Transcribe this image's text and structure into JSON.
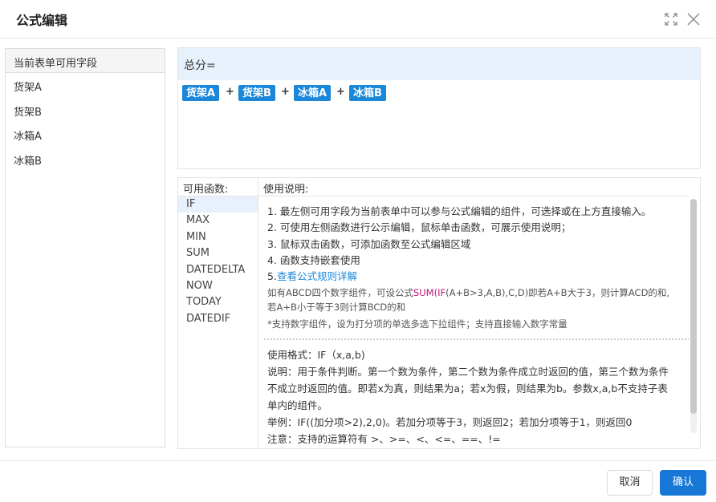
{
  "dialog": {
    "title": "公式编辑"
  },
  "icons": {
    "expand": "expand-icon",
    "close": "close-icon"
  },
  "fields_panel": {
    "header": "当前表单可用字段",
    "items": [
      "货架A",
      "货架B",
      "冰箱A",
      "冰箱B"
    ]
  },
  "editor": {
    "label": "总分=",
    "tokens": [
      {
        "type": "field",
        "text": "货架A"
      },
      {
        "type": "op",
        "text": "+"
      },
      {
        "type": "field",
        "text": "货架B"
      },
      {
        "type": "op",
        "text": "+"
      },
      {
        "type": "field",
        "text": "冰箱A"
      },
      {
        "type": "op",
        "text": "+"
      },
      {
        "type": "field",
        "text": "冰箱B"
      }
    ]
  },
  "functions": {
    "header": "可用函数:",
    "items": [
      "IF",
      "MAX",
      "MIN",
      "SUM",
      "DATEDELTA",
      "NOW",
      "TODAY",
      "DATEDIF"
    ],
    "selected": "IF"
  },
  "instructions": {
    "header": "使用说明:",
    "lines": [
      "1. 最左侧可用字段为当前表单中可以参与公式编辑的组件，可选择或在上方直接输入。",
      "2. 可使用左侧函数进行公示编辑，鼠标单击函数，可展示使用说明；",
      "3. 鼠标双击函数，可添加函数至公式编辑区域",
      "4. 函数支持嵌套使用"
    ],
    "line5_prefix": "5.",
    "line5_link": "查看公式规则详解",
    "example_part1": "如有ABCD四个数字组件，可设公式",
    "example_sum": "SUM",
    "example_paren": "(",
    "example_if": "IF",
    "example_part2": "(A+B>3,A,B),C,D)即若A+B大于3，则计算ACD的和,",
    "example_line2": "若A+B小于等于3则计算BCD的和",
    "note": "*支持数字组件，设为打分项的单选多选下拉组件；支持直接输入数字常量",
    "usage": [
      "使用格式：IF（x,a,b)",
      "说明：用于条件判断。第一个数为条件，第二个数为条件成立时返回的值，第三个数为条件",
      "不成立时返回的值。即若x为真，则结果为a；若x为假，则结果为b。参数x,a,b不支持子表",
      "单内的组件。",
      "举例：IF((加分项>2),2,0)。若加分项等于3，则返回2；若加分项等于1，则返回0",
      "注意：支持的运算符有 >、>=、<、<=、==、!="
    ]
  },
  "footer": {
    "cancel": "取消",
    "confirm": "确认"
  },
  "colors": {
    "accent": "#1677d6",
    "tag": "#1a87d9",
    "highlight": "#e6f1fb",
    "keyword": "#c0137a"
  }
}
